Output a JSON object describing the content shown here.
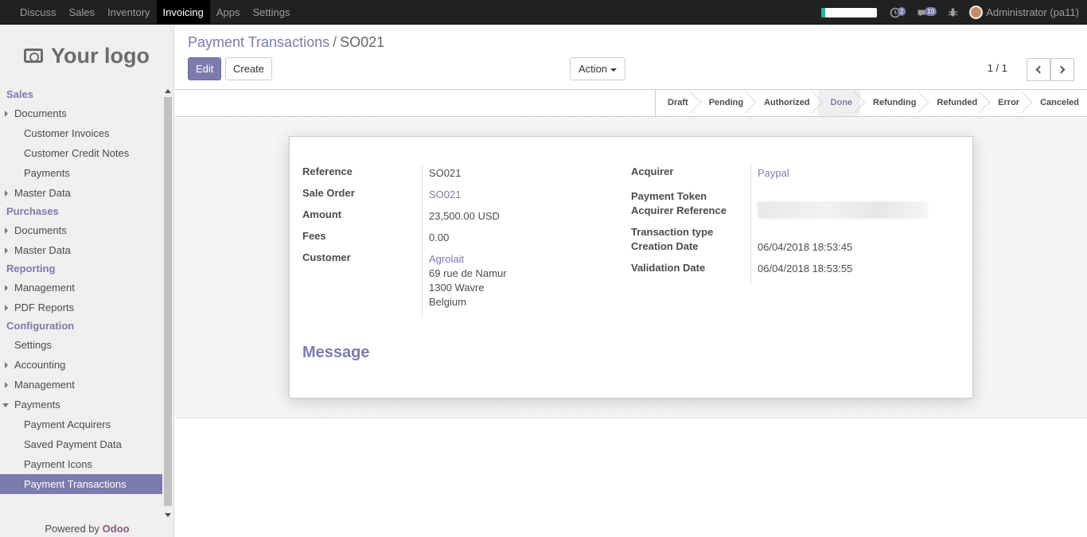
{
  "topbar": {
    "menu": [
      "Discuss",
      "Sales",
      "Inventory",
      "Invoicing",
      "Apps",
      "Settings"
    ],
    "active": "Invoicing",
    "progress_fraction": 0.08,
    "activity_count": "2",
    "message_count": "10",
    "user": "Administrator (pa11)"
  },
  "sidebar": {
    "logo_text": "Your logo",
    "sections": [
      {
        "title": "Sales",
        "items": [
          {
            "label": "Documents",
            "type": "group"
          },
          {
            "label": "Customer Invoices",
            "type": "sub"
          },
          {
            "label": "Customer Credit Notes",
            "type": "sub"
          },
          {
            "label": "Payments",
            "type": "sub"
          },
          {
            "label": "Master Data",
            "type": "group"
          }
        ]
      },
      {
        "title": "Purchases",
        "items": [
          {
            "label": "Documents",
            "type": "group"
          },
          {
            "label": "Master Data",
            "type": "group"
          }
        ]
      },
      {
        "title": "Reporting",
        "items": [
          {
            "label": "Management",
            "type": "group"
          },
          {
            "label": "PDF Reports",
            "type": "group"
          }
        ]
      },
      {
        "title": "Configuration",
        "items": [
          {
            "label": "Settings",
            "type": "plain"
          },
          {
            "label": "Accounting",
            "type": "group"
          },
          {
            "label": "Management",
            "type": "group"
          },
          {
            "label": "Payments",
            "type": "open"
          },
          {
            "label": "Payment Acquirers",
            "type": "sub"
          },
          {
            "label": "Saved Payment Data",
            "type": "sub"
          },
          {
            "label": "Payment Icons",
            "type": "sub"
          },
          {
            "label": "Payment Transactions",
            "type": "sub",
            "active": true
          }
        ]
      }
    ],
    "powered_prefix": "Powered by",
    "powered_brand": "Odoo"
  },
  "breadcrumb": {
    "parent": "Payment Transactions",
    "separator": "/",
    "current": "SO021"
  },
  "buttons": {
    "edit": "Edit",
    "create": "Create",
    "action": "Action"
  },
  "pager": {
    "value": "1 / 1"
  },
  "stages": [
    "Draft",
    "Pending",
    "Authorized",
    "Done",
    "Refunding",
    "Refunded",
    "Error",
    "Canceled"
  ],
  "current_stage": "Done",
  "form": {
    "left": [
      {
        "label": "Reference",
        "value": "SO021"
      },
      {
        "label": "Sale Order",
        "value": "SO021",
        "link": true
      },
      {
        "label": "Amount",
        "value": "23,500.00 USD"
      },
      {
        "label": "Fees",
        "value": "0.00"
      },
      {
        "label": "Customer",
        "value": "Agrolait",
        "link": true,
        "address": [
          "69 rue de Namur",
          "1300 Wavre",
          "Belgium"
        ]
      }
    ],
    "right": [
      {
        "label": "Acquirer",
        "value": "Paypal",
        "link": true
      },
      {
        "label": "Payment Token",
        "value": ""
      },
      {
        "label": "Acquirer Reference",
        "value": ""
      },
      {
        "label": "Transaction type",
        "value": ""
      },
      {
        "label": "Creation Date",
        "value": "06/04/2018 18:53:45"
      },
      {
        "label": "Validation Date",
        "value": "06/04/2018 18:53:55"
      }
    ],
    "message_heading": "Message"
  }
}
